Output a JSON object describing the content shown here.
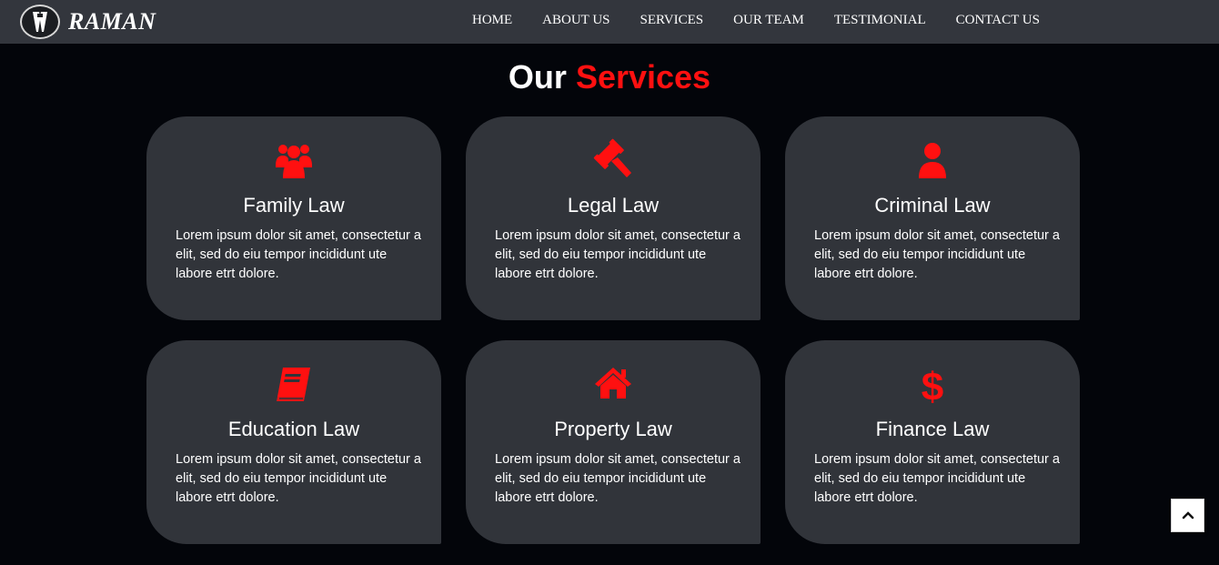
{
  "brand": {
    "name": "RAMAN",
    "logo_icon": "advocate-band-icon"
  },
  "nav": {
    "items": [
      {
        "label": "HOME"
      },
      {
        "label": "ABOUT US"
      },
      {
        "label": "SERVICES"
      },
      {
        "label": "OUR TEAM"
      },
      {
        "label": "TESTIMONIAL"
      },
      {
        "label": "CONTACT US"
      }
    ]
  },
  "services": {
    "title_prefix": "Our",
    "title_accent": "Services",
    "accent_color": "#ff1010",
    "cards": [
      {
        "icon": "users-icon",
        "title": "Family Law",
        "text": "Lorem ipsum dolor sit amet, consectetur a elit, sed do eiu tempor incididunt ute labore etrt dolore."
      },
      {
        "icon": "gavel-icon",
        "title": "Legal Law",
        "text": "Lorem ipsum dolor sit amet, consectetur a elit, sed do eiu tempor incididunt ute labore etrt dolore."
      },
      {
        "icon": "user-icon",
        "title": "Criminal Law",
        "text": "Lorem ipsum dolor sit amet, consectetur a elit, sed do eiu tempor incididunt ute labore etrt dolore."
      },
      {
        "icon": "book-icon",
        "title": "Education Law",
        "text": "Lorem ipsum dolor sit amet, consectetur a elit, sed do eiu tempor incididunt ute labore etrt dolore."
      },
      {
        "icon": "home-icon",
        "title": "Property Law",
        "text": "Lorem ipsum dolor sit amet, consectetur a elit, sed do eiu tempor incididunt ute labore etrt dolore."
      },
      {
        "icon": "dollar-icon",
        "title": "Finance Law",
        "text": "Lorem ipsum dolor sit amet, consectetur a elit, sed do eiu tempor incididunt ute labore etrt dolore."
      }
    ]
  },
  "back_to_top": {
    "icon": "chevron-up-icon"
  }
}
